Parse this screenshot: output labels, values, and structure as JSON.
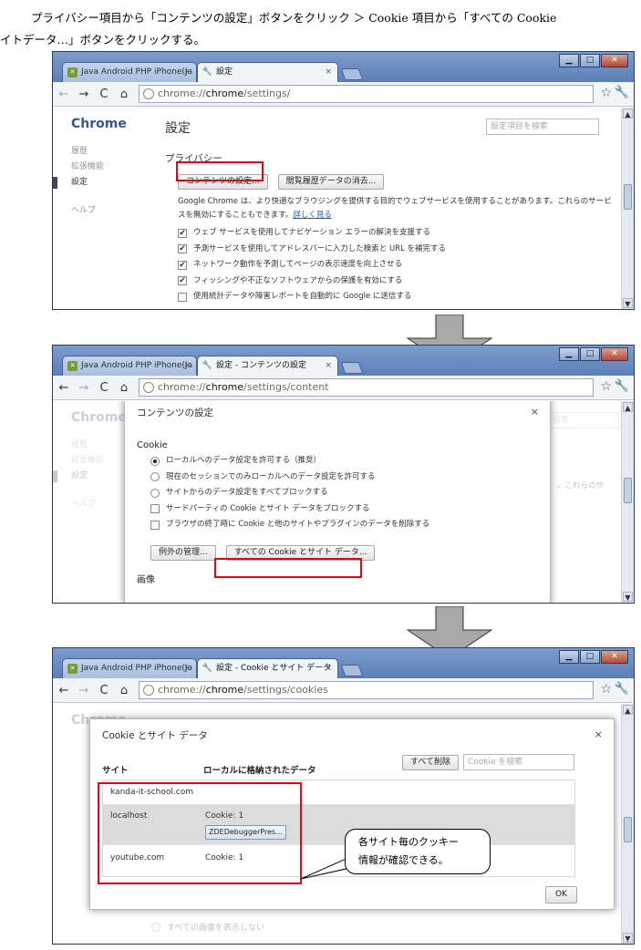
{
  "instruction": {
    "line1": "プライバシー項目から「コンテンツの設定」ボタンをクリック ＞ Cookie 項目から「すべての Cookie",
    "line2": "イトデータ…」ボタンをクリックする。"
  },
  "chrome": {
    "inactive_tab": "Java Android PHP iPhone(Ja",
    "url_prefix": "chrome://",
    "url_host": "chrome",
    "wc_min": "▁",
    "wc_max": "□",
    "wc_close": "✕",
    "close": "×",
    "back": "←",
    "forward": "→",
    "reload": "C",
    "home": "⌂",
    "star": "☆",
    "wrench": "🔧"
  },
  "screen1": {
    "tab_title": "設定",
    "url_path": "/settings/",
    "sidebar": {
      "brand": "Chrome",
      "items": [
        "履歴",
        "拡張機能",
        "設定",
        "ヘルプ"
      ]
    },
    "page_title": "設定",
    "search_placeholder": "設定項目を検索",
    "section": "プライバシー",
    "buttons": {
      "content_settings": "コンテンツの設定...",
      "clear_data": "閲覧履歴データの消去..."
    },
    "description": "Google Chrome は、より快適なブラウジングを提供する目的でウェブサービスを使用することがあります。これらのサービスを無効にすることもできます。",
    "learn_more": "詳しく見る",
    "checkboxes": [
      {
        "label": "ウェブ サービスを使用してナビゲーション エラーの解決を支援する",
        "checked": true
      },
      {
        "label": "予測サービスを使用してアドレスバーに入力した検索と URL を補完する",
        "checked": true
      },
      {
        "label": "ネットワーク動作を予測してページの表示速度を向上させる",
        "checked": true
      },
      {
        "label": "フィッシングや不正なソフトウェアからの保護を有効にする",
        "checked": true
      },
      {
        "label": "使用統計データや障害レポートを自動的に Google に送信する",
        "checked": false
      }
    ]
  },
  "screen2": {
    "tab_title": "設定 - コンテンツの設定",
    "url_path": "/settings/content",
    "background": {
      "brand": "Chrome",
      "items": [
        "履歴",
        "拡張機能",
        "設定",
        "ヘルプ"
      ],
      "search_frag": "検索",
      "desc_frag": "。これらのサ"
    },
    "dialog": {
      "title": "コンテンツの設定",
      "section": "Cookie",
      "radios": [
        {
          "label": "ローカルへのデータ設定を許可する（推奨）",
          "selected": true
        },
        {
          "label": "現在のセッションでのみローカルへのデータ設定を許可する",
          "selected": false
        },
        {
          "label": "サイトからのデータ設定をすべてブロックする",
          "selected": false
        }
      ],
      "checkboxes": [
        {
          "label": "サードパーティの Cookie とサイト データをブロックする",
          "checked": false
        },
        {
          "label": "ブラウザの終了時に Cookie と他のサイトやプラグインのデータを削除する",
          "checked": false
        }
      ],
      "buttons": {
        "exceptions": "例外の管理...",
        "all_cookies": "すべての Cookie とサイト データ..."
      },
      "next_section": "画像"
    }
  },
  "screen3": {
    "tab_title": "設定 - Cookie とサイト データ",
    "url_path": "/settings/cookies",
    "background": {
      "brand": "Chrome",
      "bottom_text": "すべての画像を表示しない"
    },
    "dialog": {
      "title": "Cookie とサイト データ",
      "col_site": "サイト",
      "col_data": "ローカルに格納されたデータ",
      "remove_all": "すべて削除",
      "search_placeholder": "Cookie を検索",
      "rows": [
        {
          "site": "kanda-it-school.com",
          "data": "",
          "chip": ""
        },
        {
          "site": "localhost",
          "data": "Cookie: 1",
          "chip": "ZDEDebuggerPres..."
        },
        {
          "site": "youtube.com",
          "data": "Cookie: 1",
          "chip": ""
        }
      ],
      "ok": "OK"
    },
    "callout": {
      "line1": "各サイト毎のクッキー",
      "line2": "情報が確認できる。"
    }
  },
  "colors": {
    "highlight": "#e60012",
    "titlebar": "#6d8cc1",
    "arrow": "#a8a8a8"
  }
}
